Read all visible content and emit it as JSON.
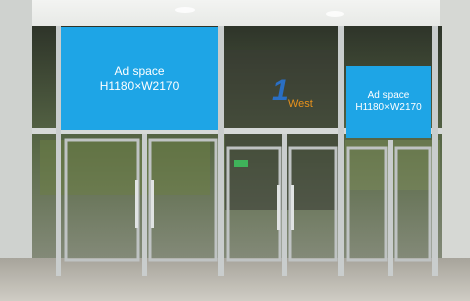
{
  "ad_left": {
    "line1": "Ad space",
    "line2": "H1180×W2170"
  },
  "ad_right": {
    "line1": "Ad space",
    "line2": "H1180×W2170"
  },
  "entrance_sign": {
    "number": "1",
    "word": "West"
  },
  "colors": {
    "ad_panel": "#1ea5e6",
    "ceiling": "#e9ebe8",
    "glass": "#4a5340",
    "frame": "#c9cdcd",
    "floor": "#b9b6ae",
    "sign_number": "#2a6fc4",
    "sign_word": "#e8921c"
  }
}
